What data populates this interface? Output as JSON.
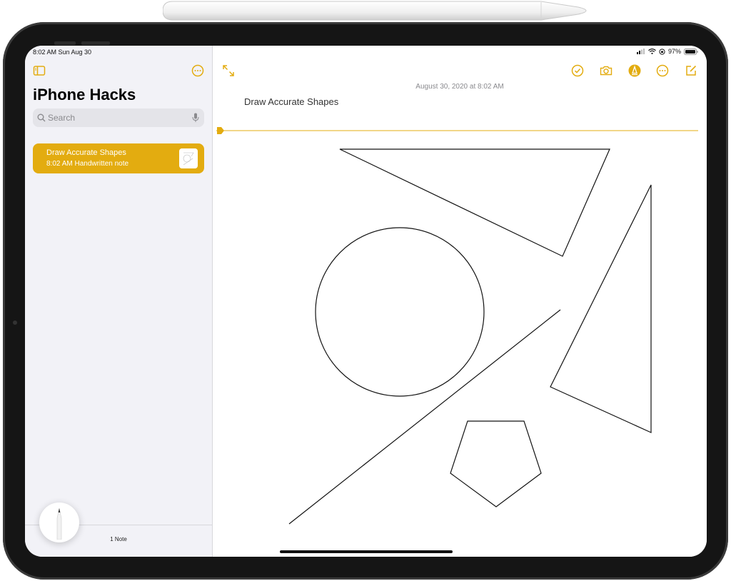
{
  "status": {
    "time_date": "8:02 AM   Sun Aug 30",
    "battery": "97%"
  },
  "sidebar": {
    "title": "iPhone Hacks",
    "search_placeholder": "Search",
    "notes": [
      {
        "title": "Draw Accurate Shapes",
        "subtitle": "8:02 AM  Handwritten note"
      }
    ],
    "count": "1 Note"
  },
  "note": {
    "date": "August 30, 2020 at 8:02 AM",
    "heading": "Draw Accurate Shapes"
  },
  "colors": {
    "accent": "#e3ac10",
    "sidebar_bg": "#f2f2f7"
  },
  "icons": {
    "sidebar_toggle": "sidebar-icon",
    "more": "ellipsis-circle-icon",
    "expand": "expand-arrows-icon",
    "checklist": "checkmark-circle-icon",
    "camera": "camera-icon",
    "markup": "pen-tip-circle-icon",
    "compose": "compose-icon",
    "search": "search-icon",
    "dictation": "microphone-icon"
  }
}
